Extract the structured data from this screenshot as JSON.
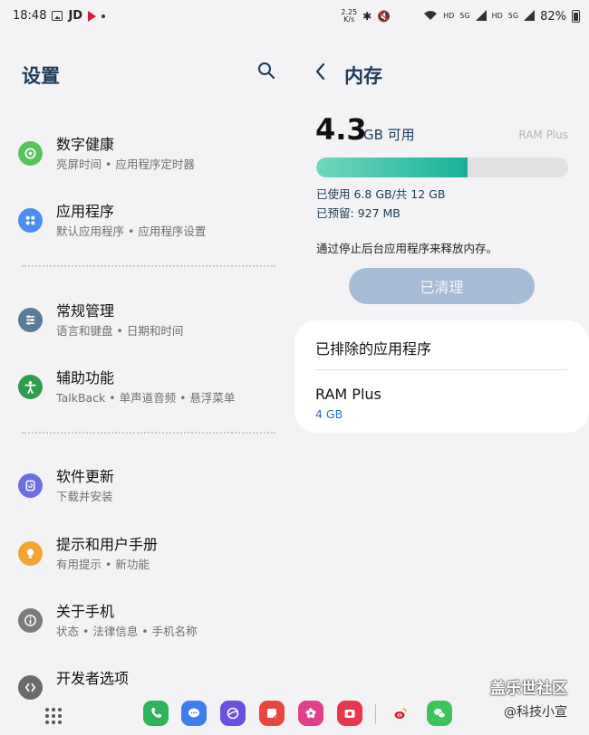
{
  "status_bar": {
    "time": "18:48",
    "carrier_app": "JD",
    "net_speed": "2.25",
    "net_unit": "K/s",
    "signal1": "HD",
    "signal2": "HD",
    "gen1": "5G",
    "gen2": "5G",
    "battery": "82%"
  },
  "left": {
    "title": "设置",
    "items": [
      {
        "title": "数字健康",
        "subtitle": "亮屏时间 • 应用程序定时器",
        "icon": "digital-wellbeing-icon",
        "color": "#59c35b"
      },
      {
        "title": "应用程序",
        "subtitle": "默认应用程序 • 应用程序设置",
        "icon": "apps-icon",
        "color": "#4a8ef0"
      },
      {
        "title": "常规管理",
        "subtitle": "语言和键盘 • 日期和时间",
        "icon": "general-management-icon",
        "color": "#5b7b99"
      },
      {
        "title": "辅助功能",
        "subtitle": "TalkBack • 单声道音频 • 悬浮菜单",
        "icon": "accessibility-icon",
        "color": "#2f9d4e"
      },
      {
        "title": "软件更新",
        "subtitle": "下载并安装",
        "icon": "software-update-icon",
        "color": "#6d6fe0"
      },
      {
        "title": "提示和用户手册",
        "subtitle": "有用提示 • 新功能",
        "icon": "tips-icon",
        "color": "#f2a531"
      },
      {
        "title": "关于手机",
        "subtitle": "状态 • 法律信息 • 手机名称",
        "icon": "info-icon",
        "color": "#7b7b7b"
      },
      {
        "title": "开发者选项",
        "subtitle": "",
        "icon": "developer-icon",
        "color": "#6b6b6b"
      }
    ]
  },
  "right": {
    "title": "内存",
    "available_value": "4.3",
    "available_unit": "GB 可用",
    "ram_plus_label": "RAM Plus",
    "used_fraction": 0.6,
    "used_text": "已使用 6.8 GB/共 12 GB",
    "reserved_text": "已预留: 927 MB",
    "note": "通过停止后台应用程序来释放内存。",
    "clean_button": "已清理",
    "excluded_apps": "已排除的应用程序",
    "ram_plus_item": "RAM Plus",
    "ram_plus_value": "4 GB"
  },
  "dock": {
    "apps": [
      {
        "name": "phone-app-icon",
        "color": "#2fb35b"
      },
      {
        "name": "messages-app-icon",
        "color": "#3e7df0"
      },
      {
        "name": "internet-app-icon",
        "color": "#6a4fe0"
      },
      {
        "name": "notes-app-icon",
        "color": "#e8473f"
      },
      {
        "name": "gallery-app-icon",
        "color": "#e23e8a"
      },
      {
        "name": "camera-app-icon",
        "color": "#e8364f"
      },
      {
        "name": "weibo-app-icon",
        "color": "#f4f4f4"
      },
      {
        "name": "wechat-app-icon",
        "color": "#3cc45a"
      }
    ]
  },
  "watermark": {
    "line1": "盖乐世社区",
    "line2": "@科技小宣"
  }
}
